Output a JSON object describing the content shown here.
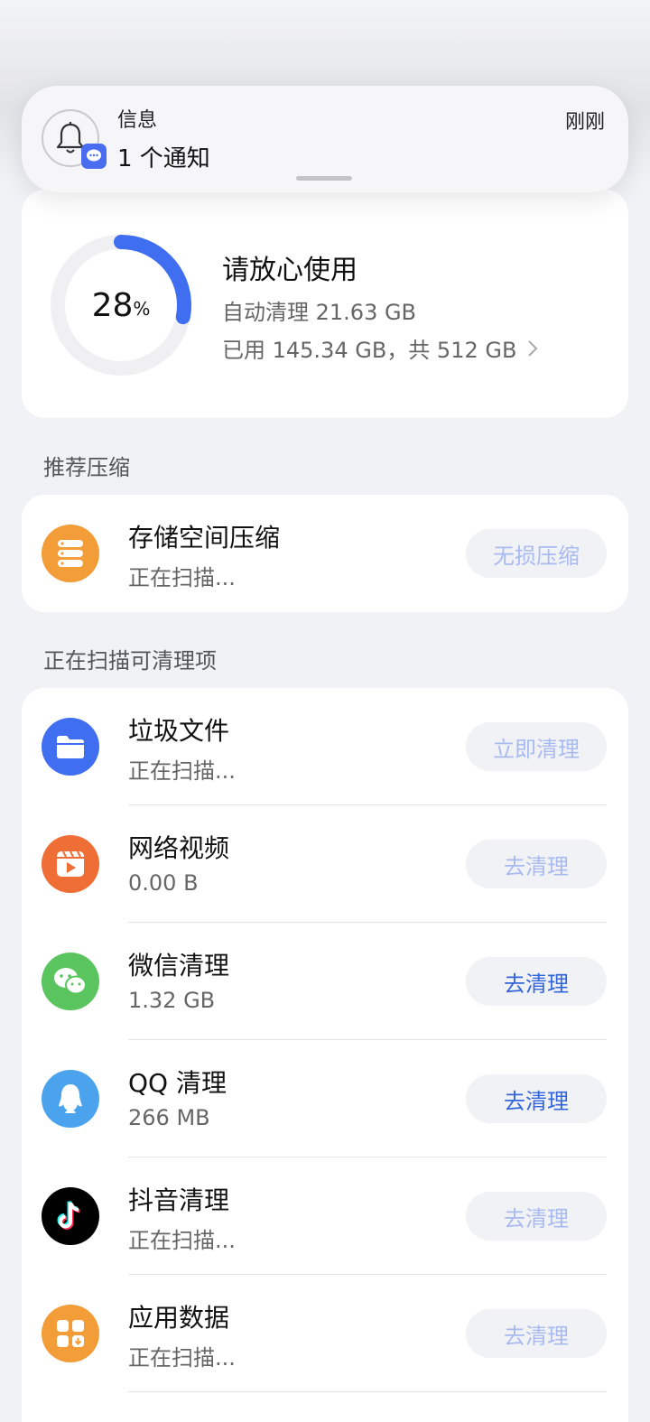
{
  "notification": {
    "app_name": "信息",
    "message": "1 个通知",
    "time": "刚刚",
    "icon": "bell-icon",
    "badge_icon": "message-icon"
  },
  "storage": {
    "percent": "28",
    "percent_unit": "%",
    "percent_value": 28,
    "status": "请放心使用",
    "auto_clean": "自动清理 21.63 GB",
    "usage": "已用 145.34 GB，共 512 GB",
    "ring_color": "#3f6ff0",
    "ring_track_color": "#f0f0f2"
  },
  "recommend": {
    "header": "推荐压缩",
    "items": [
      {
        "title": "存储空间压缩",
        "subtitle": "正在扫描...",
        "button": "无损压缩",
        "icon": "storage-stack-icon",
        "color": "#f29d38"
      }
    ]
  },
  "scan": {
    "header": "正在扫描可清理项",
    "items": [
      {
        "title": "垃圾文件",
        "subtitle": "正在扫描...",
        "button": "立即清理",
        "icon": "folder-icon",
        "color": "#3f6ff0"
      },
      {
        "title": "网络视频",
        "subtitle": "0.00 B",
        "button": "去清理",
        "icon": "video-icon",
        "color": "#ee6e35"
      },
      {
        "title": "微信清理",
        "subtitle": "1.32 GB",
        "button": "去清理",
        "icon": "wechat-icon",
        "color": "#5ac55e"
      },
      {
        "title": "QQ 清理",
        "subtitle": "266 MB",
        "button": "去清理",
        "icon": "qq-icon",
        "color": "#4aa3ec"
      },
      {
        "title": "抖音清理",
        "subtitle": "正在扫描...",
        "button": "去清理",
        "icon": "tiktok-icon",
        "color": "#000000"
      },
      {
        "title": "应用数据",
        "subtitle": "正在扫描...",
        "button": "去清理",
        "icon": "app-data-icon",
        "color": "#f29d38"
      }
    ]
  }
}
